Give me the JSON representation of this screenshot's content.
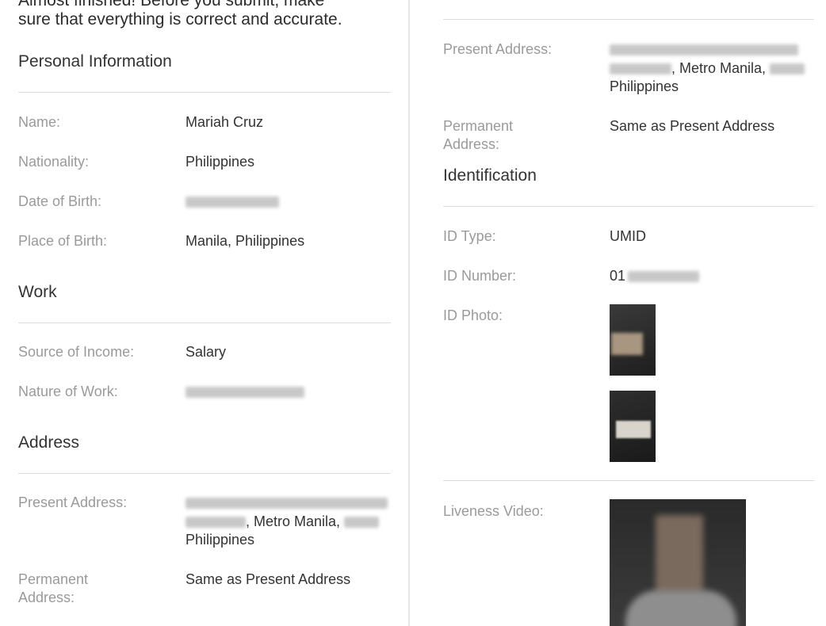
{
  "intro": {
    "line1": "Almost finished! Before you submit, make",
    "line2": "sure that everything is correct and accurate."
  },
  "personal": {
    "heading": "Personal Information",
    "rows": [
      {
        "label": "Name:",
        "value": "Mariah Cruz"
      },
      {
        "label": "Nationality:",
        "value": "Philippines"
      },
      {
        "label": "Date of Birth:",
        "value": ""
      },
      {
        "label": "Place of Birth:",
        "value": "Manila, Philippines"
      }
    ]
  },
  "work": {
    "heading": "Work",
    "rows": [
      {
        "label": "Source of Income:",
        "value": "Salary"
      },
      {
        "label": "Nature of Work:",
        "value": ""
      }
    ]
  },
  "address": {
    "heading": "Address",
    "present_label": "Present Address:",
    "present_city": ", Metro Manila,",
    "present_country": "Philippines",
    "permanent_label": "Permanent Address:",
    "permanent_value": "Same as Present Address"
  },
  "identification": {
    "heading": "Identification",
    "id_type_label": "ID Type:",
    "id_type_value": "UMID",
    "id_number_label": "ID Number:",
    "id_number_prefix": "01",
    "id_photo_label": "ID Photo:",
    "liveness_label": "Liveness Video:"
  }
}
